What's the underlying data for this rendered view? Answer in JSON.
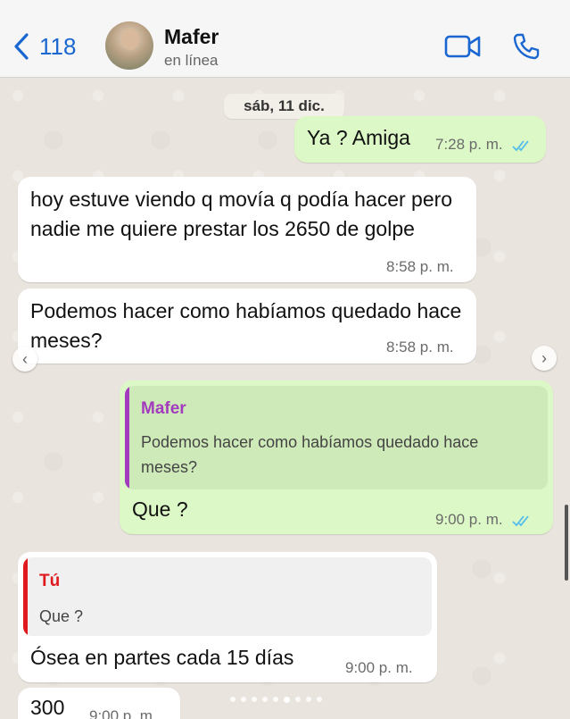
{
  "header": {
    "back_count": "118",
    "contact_name": "Mafer",
    "contact_status": "en línea"
  },
  "date_label": "sáb, 11 dic.",
  "messages": [
    {
      "text": "Ya ? Amiga",
      "time": "7:28 p. m."
    },
    {
      "text": "hoy estuve viendo q movía q podía hacer pero nadie me quiere prestar los 2650 de golpe",
      "time": "8:58 p. m."
    },
    {
      "text": "Podemos hacer como habíamos quedado hace meses?",
      "time": "8:58 p. m."
    },
    {
      "quote_name": "Mafer",
      "quote_text": "Podemos hacer como habíamos quedado hace meses?",
      "text": "Que ?",
      "time": "9:00 p. m."
    },
    {
      "quote_name": "Tú",
      "quote_text": "Que ?",
      "text": "Ósea en partes cada 15 días",
      "time": "9:00 p. m."
    },
    {
      "text": "300",
      "time": "9:00 p. m."
    }
  ],
  "colors": {
    "accent": "#1a67d2",
    "outgoing_bubble": "#dcf8c6",
    "incoming_bubble": "#ffffff",
    "read_ticks": "#53bdeb",
    "quote_mafer": "#a23bbd",
    "quote_tu": "#e0191f"
  }
}
